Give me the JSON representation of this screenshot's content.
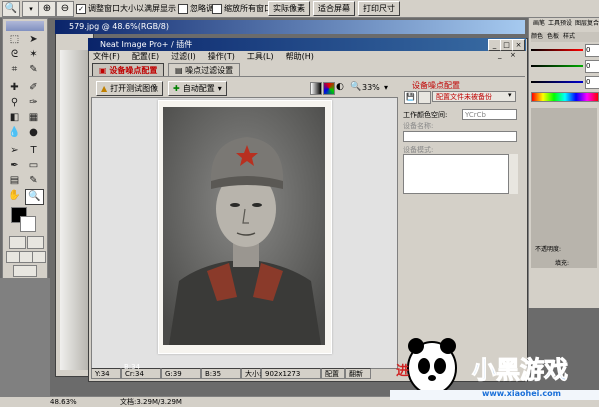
{
  "ps_options": {
    "checkbox1": "调整窗口大小以满屏显示",
    "checkbox2": "忽略调板",
    "checkbox3": "缩放所有窗口",
    "btn_actual": "实际像素",
    "btn_fit": "适合屏幕",
    "btn_print": "打印尺寸"
  },
  "doc_window": {
    "title": "579.jpg @ 48.6%(RGB/8)"
  },
  "neat_image": {
    "title": "Neat Image Pro+ / 插件",
    "menu": [
      "文件(F)",
      "配置(E)",
      "过滤(I)",
      "操作(T)",
      "工具(L)",
      "帮助(H)"
    ],
    "tabs": [
      "设备噪点配置",
      "噪点过滤设置"
    ],
    "toolbar": {
      "open_image": "打开测试图像",
      "auto_profile": "自动配置",
      "zoom": "33%"
    },
    "right_panel": {
      "section_title": "设备噪点配置",
      "profile_button": "配置文件未被备份",
      "color_space_label": "工作颜色空间:",
      "color_space_value": "YCrCb",
      "device_name_label": "设备名称:",
      "device_mode_label": "设备模式:"
    },
    "status": {
      "y": "Y:34",
      "cr": "Cr:34",
      "g": "G:39",
      "b": "B:35",
      "size_label": "大小:",
      "size": "902x1273",
      "config": "配置",
      "extra": "翻新"
    }
  },
  "photo_mini": {
    "label_a": "B:34"
  },
  "palettes": {
    "tabs_top": [
      "画笔",
      "工具预设",
      "图层复合"
    ],
    "color_tabs": [
      "颜色",
      "色板",
      "样式"
    ],
    "channels": [
      {
        "label": "R",
        "value": "0",
        "color": "#cc0000"
      },
      {
        "label": "G",
        "value": "0",
        "color": "#00aa00"
      },
      {
        "label": "B",
        "value": "0",
        "color": "#0000cc"
      }
    ],
    "opacity_label": "不透明度:",
    "fill_label": "填充:"
  },
  "ps_status": {
    "zoom": "48.63%",
    "doc": "文档:3.29M/3.29M"
  },
  "watermark": {
    "text": "小黑游戏",
    "url": "www.xiaohei.com",
    "arrow": "进"
  }
}
